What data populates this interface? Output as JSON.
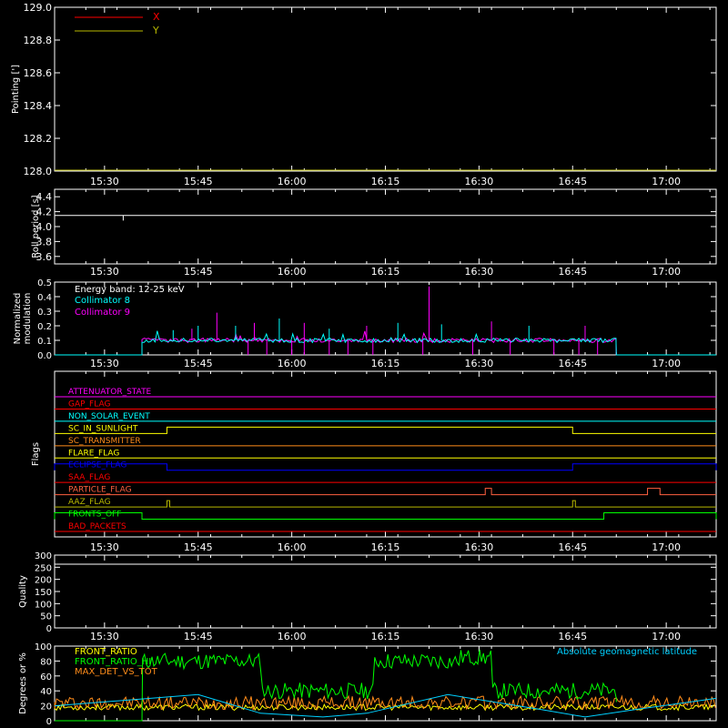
{
  "colors": {
    "background": "#000000",
    "axis": "#ffffff",
    "x": "#ff0000",
    "y": "#b8b800",
    "coll8": "#00ffff",
    "coll9": "#ff00ff",
    "front_ratio": "#ffff00",
    "front_ratio_hi": "#00ff00",
    "max_det": "#ff8c1a",
    "geomag": "#00d0ff"
  },
  "time_axis": {
    "start": "15:22",
    "end": "17:08",
    "tick_labels": [
      "15:30",
      "15:45",
      "16:00",
      "16:15",
      "16:30",
      "16:45",
      "17:00"
    ],
    "tick_minutes": [
      930,
      945,
      960,
      975,
      990,
      1005,
      1020
    ]
  },
  "chart_data": [
    {
      "type": "line",
      "ylabel": "Pointing [']",
      "ylim": [
        128.0,
        129.0
      ],
      "yticks": [
        "128.0",
        "128.2",
        "128.4",
        "128.6",
        "128.8",
        "129.0"
      ],
      "yvals": [
        128.0,
        128.2,
        128.4,
        128.6,
        128.8,
        129.0
      ],
      "legend": [
        "X",
        "Y"
      ],
      "series": [
        {
          "name": "X",
          "values": []
        },
        {
          "name": "Y",
          "values": []
        }
      ]
    },
    {
      "type": "line",
      "ylabel": "Roll period [s]",
      "ylim": [
        3.5,
        4.5
      ],
      "yticks": [
        "3.6",
        "3.8",
        "4.0",
        "4.2",
        "4.4"
      ],
      "yvals": [
        3.6,
        3.8,
        4.0,
        4.2,
        4.4
      ],
      "series": [
        {
          "values": [
            {
              "x": "15:22",
              "y": 4.15
            },
            {
              "x": "15:33",
              "y": 4.15
            },
            {
              "x": "15:33",
              "y": 4.08
            },
            {
              "x": "15:33",
              "y": 4.15
            },
            {
              "x": "17:08",
              "y": 4.15
            }
          ]
        }
      ]
    },
    {
      "type": "line",
      "ylabel_lines": [
        "Normalized",
        "modulation"
      ],
      "ylim": [
        0.0,
        0.5
      ],
      "yticks": [
        "0.0",
        "0.1",
        "0.2",
        "0.3",
        "0.4",
        "0.5"
      ],
      "yvals": [
        0.0,
        0.1,
        0.2,
        0.3,
        0.4,
        0.5
      ],
      "annotation": "Energy band: 12-25 keV",
      "legend": [
        "Collimator 8",
        "Collimator 9"
      ],
      "data_range": [
        "15:36",
        "16:52"
      ],
      "baseline": 0.1,
      "spikes": [
        {
          "x": "15:41",
          "y": 0.17
        },
        {
          "x": "15:44",
          "y": 0.18
        },
        {
          "x": "15:45",
          "y": 0.2
        },
        {
          "x": "15:48",
          "y": 0.29
        },
        {
          "x": "15:51",
          "y": 0.2
        },
        {
          "x": "15:54",
          "y": 0.22
        },
        {
          "x": "15:58",
          "y": 0.25
        },
        {
          "x": "16:02",
          "y": 0.22
        },
        {
          "x": "16:06",
          "y": 0.18
        },
        {
          "x": "16:12",
          "y": 0.2
        },
        {
          "x": "16:17",
          "y": 0.22
        },
        {
          "x": "16:22",
          "y": 0.47
        },
        {
          "x": "16:24",
          "y": 0.21
        },
        {
          "x": "16:32",
          "y": 0.23
        },
        {
          "x": "16:38",
          "y": 0.2
        },
        {
          "x": "16:47",
          "y": 0.2
        }
      ],
      "zero_drops": [
        "15:53",
        "15:56",
        "16:00",
        "16:02",
        "16:06",
        "16:09",
        "16:13",
        "16:21",
        "16:29",
        "16:35",
        "16:42",
        "16:46",
        "16:49"
      ]
    }
  ],
  "flags": {
    "ylabel": "Flags",
    "rows": [
      {
        "label": "ATTENUATOR_STATE",
        "color": "#ff00ff",
        "ranges": []
      },
      {
        "label": "GAP_FLAG",
        "color": "#ff0000",
        "ranges": []
      },
      {
        "label": "NON_SOLAR_EVENT",
        "color": "#00ffff",
        "ranges": []
      },
      {
        "label": "SC_IN_SUNLIGHT",
        "color": "#ffff00",
        "ranges": [
          [
            "15:40",
            "16:45"
          ]
        ]
      },
      {
        "label": "SC_TRANSMITTER",
        "color": "#ff8c1a",
        "ranges": []
      },
      {
        "label": "FLARE_FLAG",
        "color": "#ffff00",
        "ranges": []
      },
      {
        "label": "ECLIPSE_FLAG",
        "color": "#0000ff",
        "ranges": [
          [
            "15:22",
            "15:40"
          ],
          [
            "16:45",
            "17:08"
          ]
        ]
      },
      {
        "label": "SAA_FLAG",
        "color": "#ff0000",
        "ranges": []
      },
      {
        "label": "PARTICLE_FLAG",
        "color": "#ff6040",
        "ranges": [
          [
            "16:31",
            "16:32"
          ],
          [
            "16:57",
            "16:59"
          ]
        ]
      },
      {
        "label": "AAZ_FLAG",
        "color": "#b8b800",
        "ranges": [
          [
            "15:40",
            "15:40"
          ],
          [
            "16:45",
            "16:45"
          ]
        ]
      },
      {
        "label": "FRONTS_OFF",
        "color": "#00ff00",
        "ranges": [
          [
            "15:22",
            "15:36"
          ],
          [
            "16:50",
            "17:08"
          ]
        ]
      },
      {
        "label": "BAD_PACKETS",
        "color": "#ff0000",
        "ranges": []
      }
    ]
  },
  "quality": {
    "ylabel": "Quality",
    "ylim": [
      0,
      300
    ],
    "yticks": [
      "0",
      "50",
      "100",
      "150",
      "200",
      "250",
      "300"
    ],
    "yvals": [
      0,
      50,
      100,
      150,
      200,
      250,
      300
    ]
  },
  "bottom": {
    "ylabel": "Degrees or %",
    "ylim": [
      0,
      100
    ],
    "yticks": [
      "0",
      "20",
      "40",
      "60",
      "80",
      "100"
    ],
    "yvals": [
      0,
      20,
      40,
      60,
      80,
      100
    ],
    "legend": [
      "FRONT_RATIO",
      "FRONT_RATIO_HI",
      "MAX_DET_VS_TOT"
    ],
    "right_label": "Absolute geomagnetic latitude",
    "front_ratio_hi_levels": [
      {
        "x": "15:36",
        "y": 80
      },
      {
        "x": "15:55",
        "y": 40
      },
      {
        "x": "16:13",
        "y": 80
      },
      {
        "x": "16:27",
        "y": 85
      },
      {
        "x": "16:32",
        "y": 40
      },
      {
        "x": "16:52",
        "y": 40
      }
    ],
    "geomag": [
      {
        "x": "15:22",
        "y": 20
      },
      {
        "x": "15:45",
        "y": 35
      },
      {
        "x": "15:55",
        "y": 10
      },
      {
        "x": "16:05",
        "y": 5
      },
      {
        "x": "16:12",
        "y": 10
      },
      {
        "x": "16:25",
        "y": 35
      },
      {
        "x": "16:40",
        "y": 15
      },
      {
        "x": "16:47",
        "y": 5
      },
      {
        "x": "16:55",
        "y": 15
      },
      {
        "x": "17:08",
        "y": 30
      }
    ]
  }
}
